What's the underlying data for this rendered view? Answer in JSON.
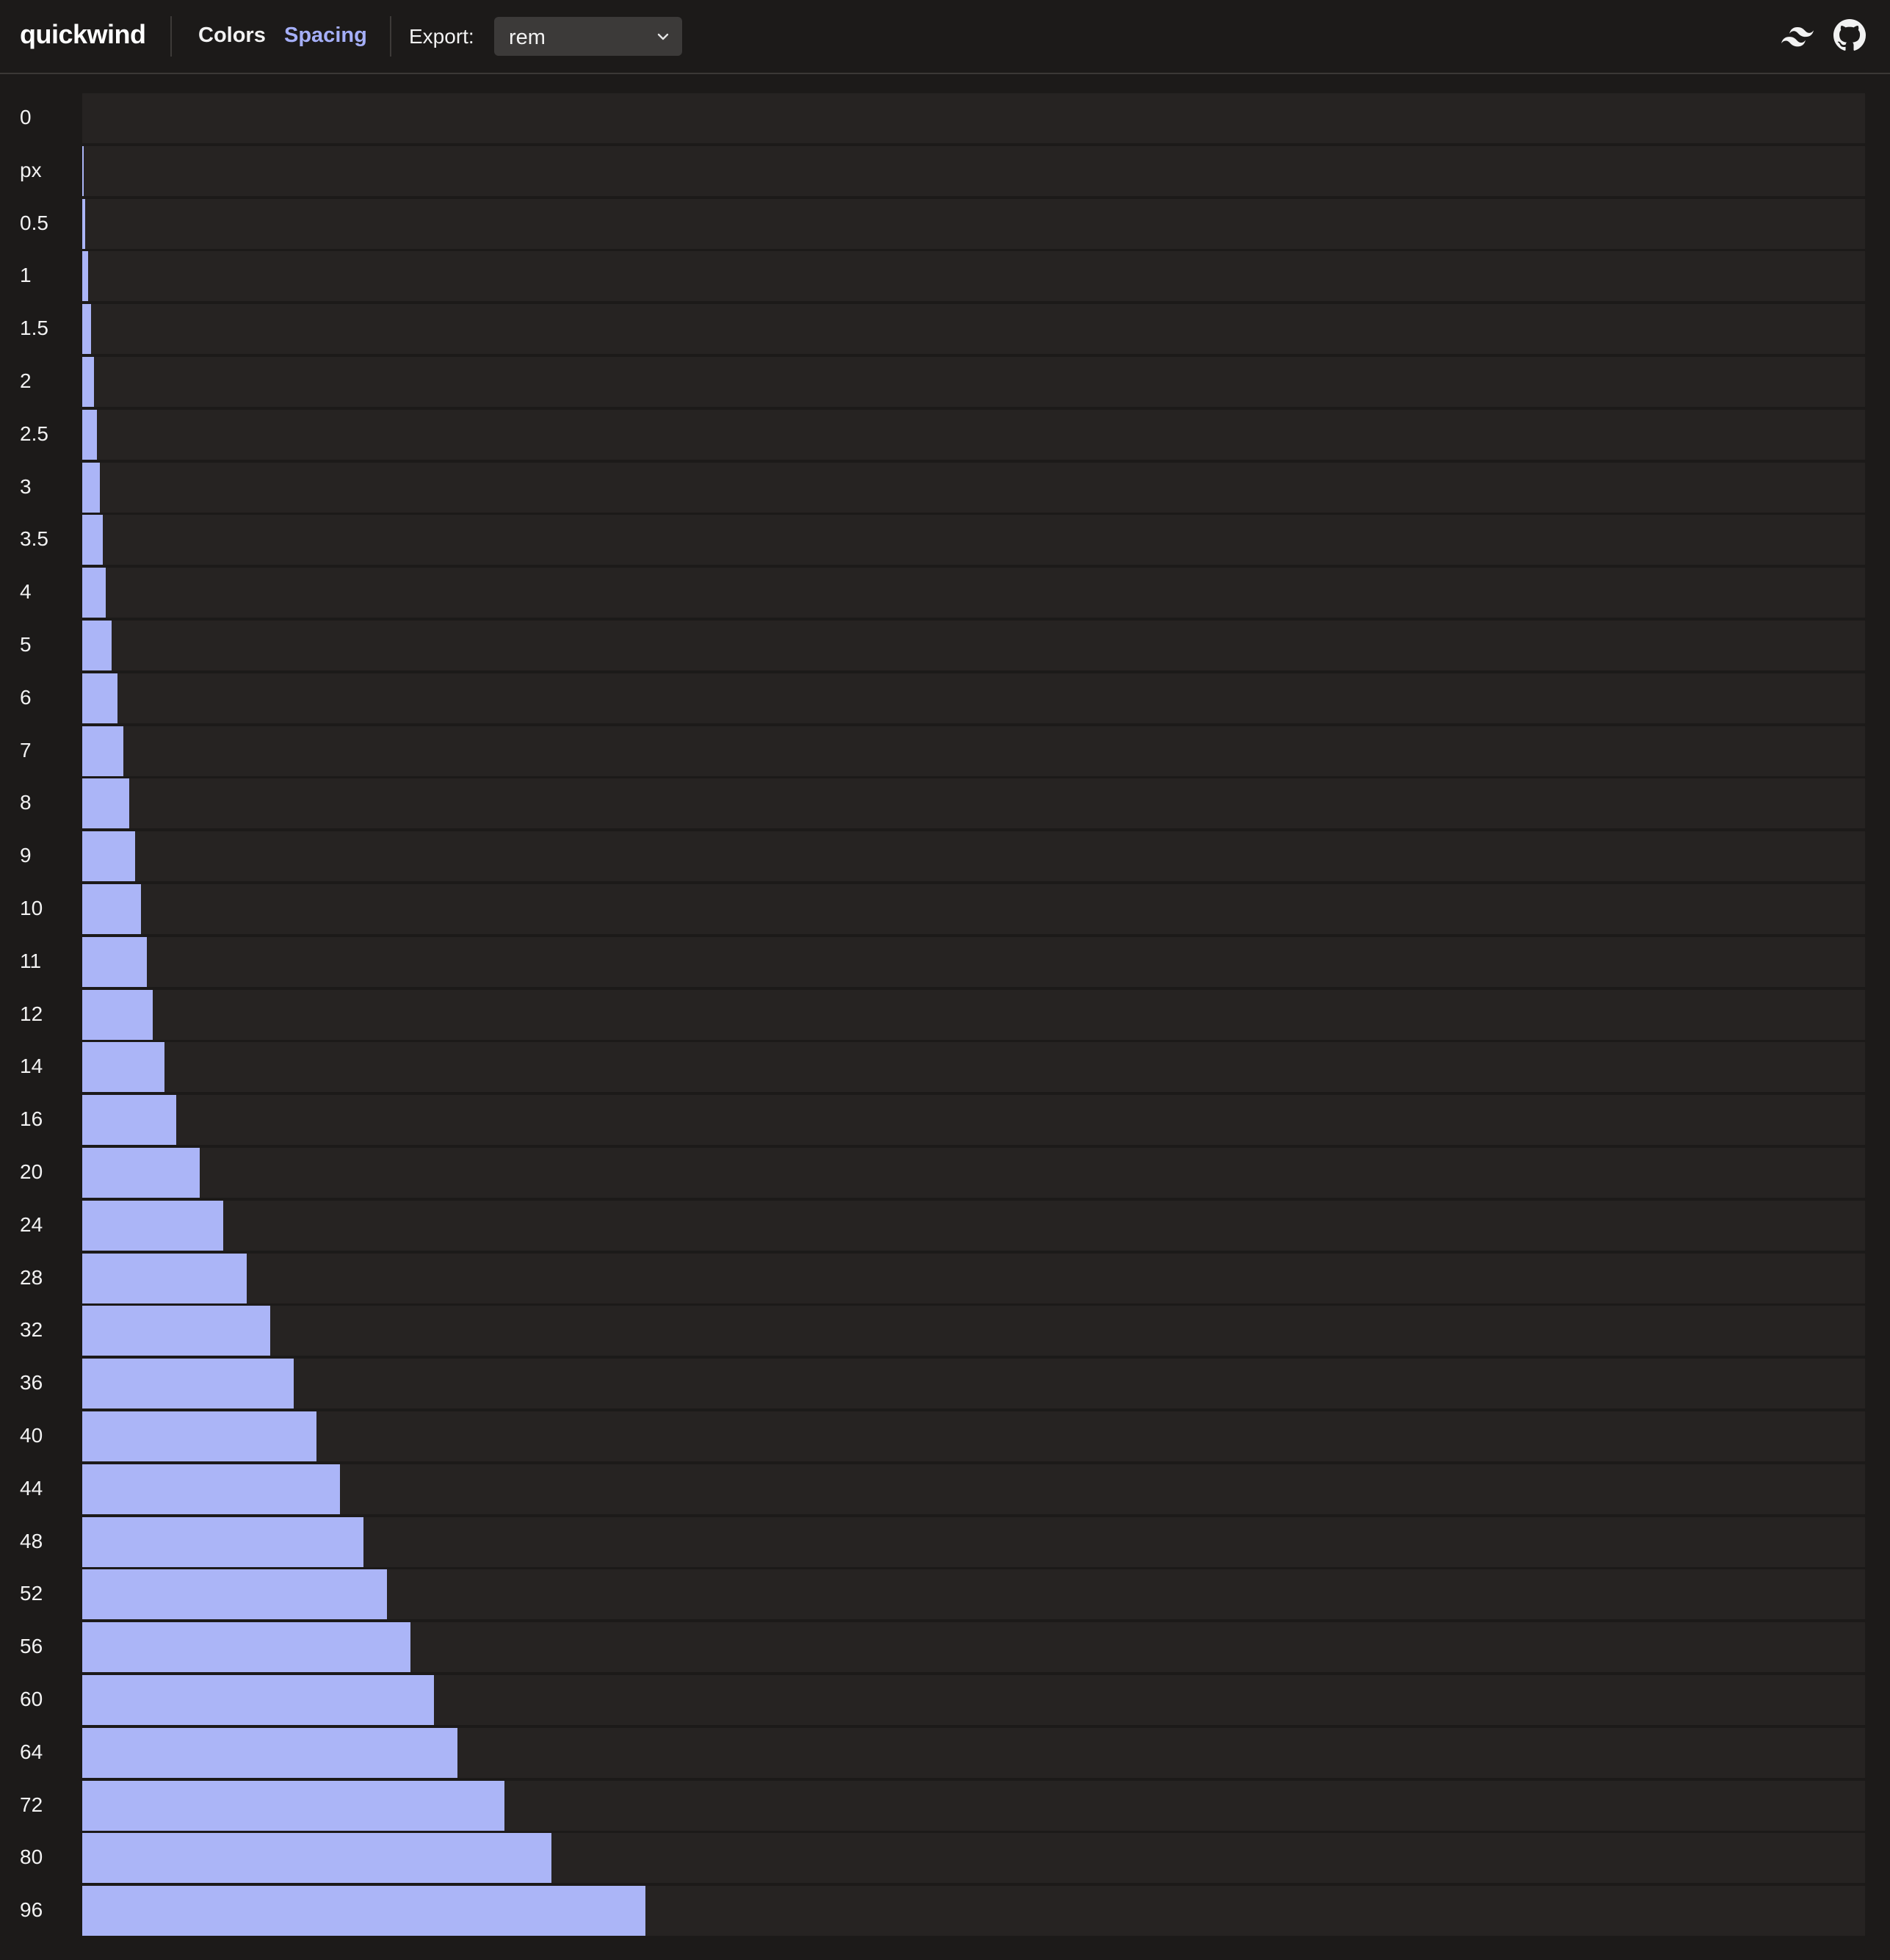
{
  "app": {
    "title": "quickwind"
  },
  "nav": {
    "colors_label": "Colors",
    "spacing_label": "Spacing",
    "active": "Spacing"
  },
  "export": {
    "label": "Export:",
    "selected": "rem"
  },
  "icons": {
    "tailwind": "tailwind-logo-icon",
    "github": "github-icon"
  },
  "colors": {
    "accent": "#a5aff8",
    "bar": "#abb5f7",
    "track": "#262322",
    "background": "#1c1a19"
  },
  "chart_data": {
    "type": "bar",
    "orientation": "horizontal",
    "categories": [
      "0",
      "px",
      "0.5",
      "1",
      "1.5",
      "2",
      "2.5",
      "3",
      "3.5",
      "4",
      "5",
      "6",
      "7",
      "8",
      "9",
      "10",
      "11",
      "12",
      "14",
      "16",
      "20",
      "24",
      "28",
      "32",
      "36",
      "40",
      "44",
      "48",
      "52",
      "56",
      "60",
      "64",
      "72",
      "80",
      "96"
    ],
    "values": [
      0,
      0.0625,
      0.125,
      0.25,
      0.375,
      0.5,
      0.625,
      0.75,
      0.875,
      1,
      1.25,
      1.5,
      1.75,
      2,
      2.25,
      2.5,
      2.75,
      3,
      3.5,
      4,
      5,
      6,
      7,
      8,
      9,
      10,
      11,
      12,
      13,
      14,
      15,
      16,
      18,
      20,
      24
    ],
    "unit": "rem",
    "xlim": [
      0,
      76
    ]
  }
}
